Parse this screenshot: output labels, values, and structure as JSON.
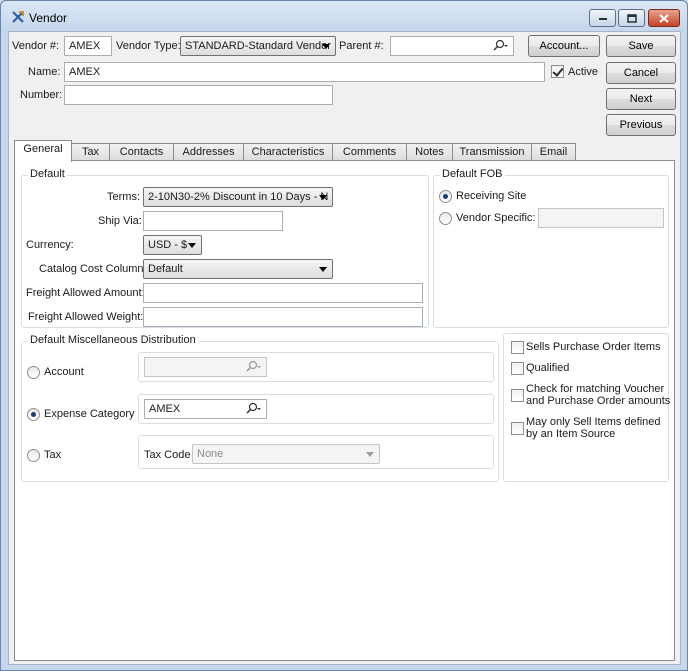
{
  "window": {
    "title": "Vendor"
  },
  "header": {
    "vendor_label": "Vendor #:",
    "vendor_value": "AMEX",
    "vendor_type_label": "Vendor Type:",
    "vendor_type_value": "STANDARD-Standard Vendor",
    "parent_label": "Parent #:",
    "parent_value": "",
    "account_button": "Account...",
    "name_label": "Name:",
    "name_value": "AMEX",
    "active_label": "Active",
    "active_checked": true,
    "number_label": "Number:",
    "number_value": ""
  },
  "actions": {
    "save": "Save",
    "cancel": "Cancel",
    "next": "Next",
    "previous": "Previous"
  },
  "tabs": [
    {
      "label": "General",
      "active": true
    },
    {
      "label": "Tax"
    },
    {
      "label": "Contacts"
    },
    {
      "label": "Addresses"
    },
    {
      "label": "Characteristics"
    },
    {
      "label": "Comments"
    },
    {
      "label": "Notes"
    },
    {
      "label": "Transmission"
    },
    {
      "label": "Email"
    }
  ],
  "default_group": {
    "title": "Default",
    "terms_label": "Terms:",
    "terms_value": "2-10N30-2% Discount in 10 Days - N",
    "ship_via_label": "Ship Via:",
    "ship_via_value": "",
    "currency_label": "Currency:",
    "currency_value": "USD - $",
    "catalog_cost_label": "Catalog Cost Column:",
    "catalog_cost_value": "Default",
    "freight_amount_label": "Freight Allowed Amount:",
    "freight_amount_value": "",
    "freight_weight_label": "Freight Allowed Weight:",
    "freight_weight_value": ""
  },
  "fob_group": {
    "title": "Default FOB",
    "receiving_site_label": "Receiving Site",
    "vendor_specific_label": "Vendor Specific:",
    "vendor_specific_value": "",
    "selected": "receiving_site"
  },
  "misc_group": {
    "title": "Default Miscellaneous Distribution",
    "account_label": "Account",
    "account_value": "",
    "expense_label": "Expense Category",
    "expense_value": "AMEX",
    "tax_label": "Tax",
    "tax_code_label": "Tax Code",
    "tax_code_value": "None",
    "selected": "expense_category"
  },
  "options": {
    "sells_po_items": {
      "label": "Sells Purchase Order Items",
      "checked": false
    },
    "qualified": {
      "label": "Qualified",
      "checked": false
    },
    "check_matching": {
      "label_line1": "Check for matching Voucher",
      "label_line2": "and Purchase Order amounts",
      "checked": false
    },
    "may_only_sell": {
      "label_line1": "May only Sell Items defined",
      "label_line2": "by an Item Source",
      "checked": false
    }
  },
  "colors": {
    "selection_radio": "#1c3b7a",
    "close_button": "#c4442a"
  }
}
